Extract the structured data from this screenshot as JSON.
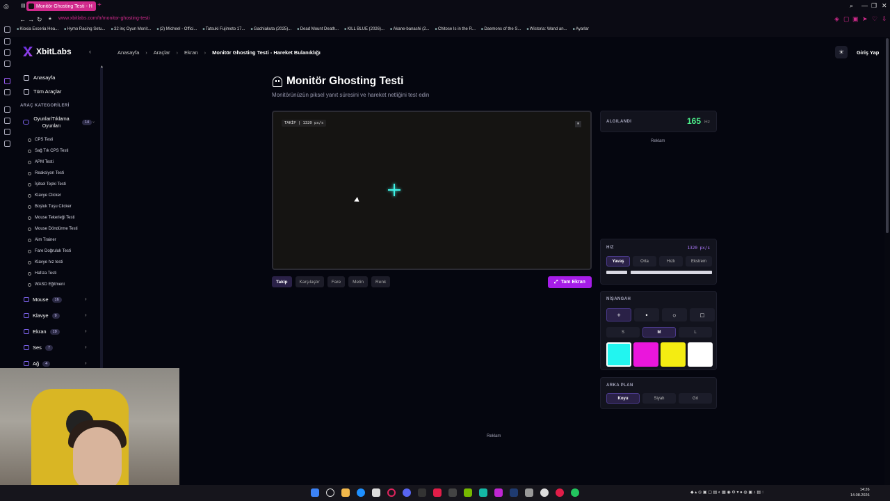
{
  "browser": {
    "tab_title": "Monitör Ghosting Testi - H",
    "url": "www.xbitlabs.com/tr/monitor-ghosting-testi",
    "bookmarks": [
      "Kioxia Exceria Hea...",
      "Hymo Racing Setu...",
      "32 inç Oyun Monit...",
      "(2) Micheel - Offici...",
      "Tatsuki Fujimoto 17...",
      "Gachiakuta (2025)...",
      "Dead Mount Death...",
      "KILL BLUE (2026)...",
      "Akane-banashi (2...",
      "Chitose Is in the R...",
      "Daemons of the S...",
      "Wistoria: Wand an...",
      "Ayarlar"
    ]
  },
  "header": {
    "brand": "XbitLabs",
    "breadcrumbs": [
      "Anasayfa",
      "Araçlar",
      "Ekran",
      "Monitör Ghosting Testi - Hareket Bulanıklığı"
    ],
    "login": "Giriş Yap"
  },
  "sidebar": {
    "home": "Anasayfa",
    "all_tools": "Tüm Araçlar",
    "section_heading": "ARAÇ KATEGORİLERİ",
    "games_category": {
      "label": "Oyunlar/Tıklama Oyunları",
      "count": "14"
    },
    "games_items": [
      "CPS Testi",
      "Sağ Tık CPS Testi",
      "APM Testi",
      "Reaksiyon Testi",
      "İşitsel Tepki Testi",
      "Klavye Clicker",
      "Boşluk Tuşu Clicker",
      "Mouse Tekerleği Testi",
      "Mouse Döndürme Testi",
      "Aim Trainer",
      "Fare Doğruluk Testi",
      "Klavye hız testi",
      "Hafıza Testi",
      "WASD Eğitmeni"
    ],
    "categories": [
      {
        "label": "Mouse",
        "count": "16"
      },
      {
        "label": "Klavye",
        "count": "9"
      },
      {
        "label": "Ekran",
        "count": "19"
      },
      {
        "label": "Ses",
        "count": "7"
      },
      {
        "label": "Ağ",
        "count": "4"
      }
    ]
  },
  "main": {
    "title": "Monitör Ghosting Testi",
    "subtitle": "Monitörünüzün piksel yanıt süresini ve hareket netliğini test edin",
    "readout": "TAKİP | 1320 px/s",
    "modes": [
      "Takip",
      "Karşılaştır",
      "Fare",
      "Metin",
      "Renk"
    ],
    "active_mode": "Takip",
    "fullscreen": "Tam Ekran",
    "bottom_ad": "Reklam"
  },
  "panels": {
    "detected_label": "ALGILANDI",
    "detected_value": "165",
    "detected_unit": "Hz",
    "ad_label": "Reklam",
    "speed_label": "HIZ",
    "speed_value": "1320 px/s",
    "speed_options": [
      "Yavaş",
      "Orta",
      "Hızlı",
      "Ekstrem"
    ],
    "crosshair_label": "NİŞANGAH",
    "crosshair_shapes": [
      "+",
      "•",
      "○",
      "□"
    ],
    "size_options": [
      "S",
      "M",
      "L"
    ],
    "colors": [
      "#22f5f0",
      "#ea16dc",
      "#f4ec12",
      "#ffffff"
    ],
    "background_label": "ARKA PLAN",
    "background_options": [
      "Koyu",
      "Siyah",
      "Gri"
    ]
  },
  "taskbar": {
    "time": "14:26",
    "date": "14.08.2026"
  },
  "colors": {
    "accent": "#a61de8",
    "detected": "#4df08b",
    "crosshair": "#3ff2e6"
  }
}
